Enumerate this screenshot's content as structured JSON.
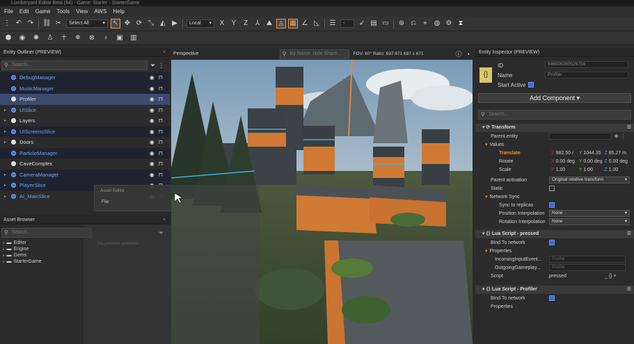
{
  "window": {
    "title": "Lumberyard Editor Beta (64) - Game: Starter - StarterGame"
  },
  "menu": [
    "File",
    "Edit",
    "Game",
    "Tools",
    "View",
    "AWS",
    "Help"
  ],
  "toolbar": {
    "select_all": "Select All",
    "space": "Local",
    "axes": [
      "X",
      "Y",
      "Z"
    ],
    "zoom_value": "-"
  },
  "outliner": {
    "title": "Entity Outliner (PREVIEW)",
    "search_placeholder": "Search...",
    "items": [
      {
        "label": "DebugManager",
        "style": "blue",
        "bg": "dark"
      },
      {
        "label": "MusicManager",
        "style": "blue",
        "bg": "dark"
      },
      {
        "label": "Profiler",
        "style": "white",
        "bg": "sel"
      },
      {
        "label": "UISlice",
        "style": "blue",
        "bg": "none"
      },
      {
        "label": "Layers",
        "style": "white",
        "bg": "none"
      },
      {
        "label": "UIScreensSlice",
        "style": "blue",
        "bg": "dark"
      },
      {
        "label": "Doors",
        "style": "white",
        "bg": "none"
      },
      {
        "label": "ParticleManager",
        "style": "blue",
        "bg": "dark"
      },
      {
        "label": "CaveComplex",
        "style": "white",
        "bg": "none"
      },
      {
        "label": "CameraManager",
        "style": "blue",
        "bg": "dark"
      },
      {
        "label": "PlayerSlice",
        "style": "blue",
        "bg": "dark"
      },
      {
        "label": "AI_MainSlice",
        "style": "blue",
        "bg": "none"
      }
    ]
  },
  "context_menu": {
    "header": "Asset Editor",
    "item": "File"
  },
  "asset_browser": {
    "title": "Asset Browser",
    "search_placeholder": "Search...",
    "folders": [
      "Editor",
      "Engine",
      "Gems",
      "StarterGame"
    ],
    "preview_text": "No preview available"
  },
  "viewport": {
    "title": "Perspective",
    "search_placeholder": "By Name, Hide Share...",
    "info": "FOV: 60°  Ratio: 697:671  697 x 671"
  },
  "inspector": {
    "title": "Entity Inspector (PREVIEW)",
    "id_label": "ID",
    "id_value": "846906060029758",
    "name_label": "Name",
    "name_value": "Profiler",
    "start_active": "Start Active",
    "add_component": "Add Component",
    "search_placeholder": "Search...",
    "transform": {
      "title": "Transform",
      "parent_entity": "Parent entity",
      "values": "Values",
      "translate": "Translate",
      "translate_xyz": [
        "982.50 r",
        "1044.35",
        "85.27 m"
      ],
      "rotate": "Rotate",
      "rotate_xyz": [
        "0.00 deg",
        "0.00 deg",
        "0.00 deg"
      ],
      "scale": "Scale",
      "scale_xyz": [
        "1.00",
        "1.00",
        "1.00"
      ],
      "parent_activation": "Parent activation",
      "parent_activation_value": "Original relative transform",
      "static": "Static",
      "network_sync": "Network Sync",
      "sync_to_replicas": "Sync to replicas",
      "position_interp": "Position Interpolation",
      "position_interp_value": "None",
      "rotation_interp": "Rotation Interpolation",
      "rotation_interp_value": "None"
    },
    "lua1": {
      "title": "Lua Script - pressed",
      "bind": "Bind To network",
      "properties": "Properties",
      "incoming": "IncomingInputEvent...",
      "incoming_value": "Profile",
      "outgoing": "OutgoingGameplay...",
      "outgoing_value": "Profile",
      "script": "Script",
      "script_value": "pressed"
    },
    "lua2": {
      "title": "Lua Script - Profiler",
      "bind": "Bind To network",
      "properties": "Properties"
    }
  }
}
